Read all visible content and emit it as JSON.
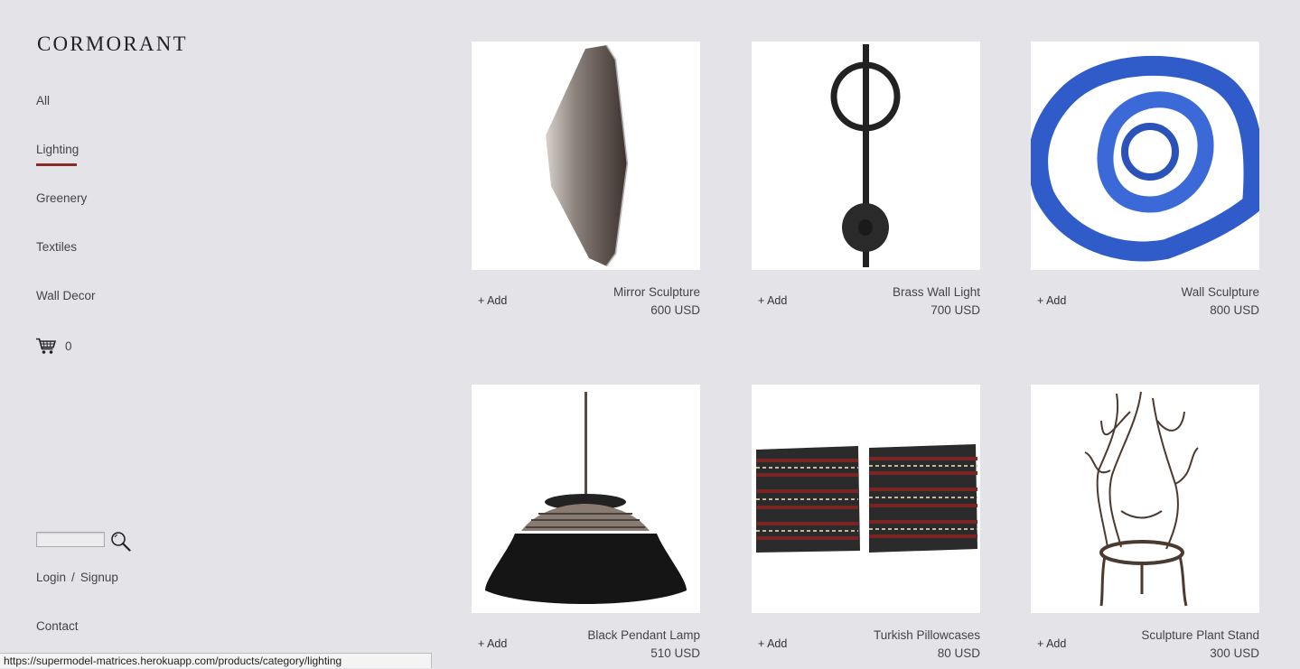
{
  "brand": {
    "name": "CORMORANT"
  },
  "nav": {
    "items": [
      {
        "label": "All"
      },
      {
        "label": "Lighting",
        "active": true
      },
      {
        "label": "Greenery"
      },
      {
        "label": "Textiles"
      },
      {
        "label": "Wall Decor"
      }
    ]
  },
  "cart": {
    "icon": "shopping-cart-icon",
    "count": "0"
  },
  "search": {
    "placeholder": "",
    "value": "",
    "icon": "magnifier-icon"
  },
  "auth": {
    "login_label": "Login",
    "separator": "/",
    "signup_label": "Signup"
  },
  "contact": {
    "label": "Contact"
  },
  "products": [
    {
      "name": "Mirror Sculpture",
      "price": "600 USD",
      "add_label": "+ Add"
    },
    {
      "name": "Brass Wall Light",
      "price": "700 USD",
      "add_label": "+ Add"
    },
    {
      "name": "Wall Sculpture",
      "price": "800 USD",
      "add_label": "+ Add"
    },
    {
      "name": "Black Pendant Lamp",
      "price": "510 USD",
      "add_label": "+ Add"
    },
    {
      "name": "Turkish Pillowcases",
      "price": "80 USD",
      "add_label": "+ Add"
    },
    {
      "name": "Sculpture Plant Stand",
      "price": "300 USD",
      "add_label": "+ Add"
    }
  ],
  "status_bar": {
    "url": "https://supermodel-matrices.herokuapp.com/products/category/lighting"
  },
  "colors": {
    "background": "#e4e4e8",
    "accent": "#8a2a2a",
    "card": "#ffffff"
  }
}
